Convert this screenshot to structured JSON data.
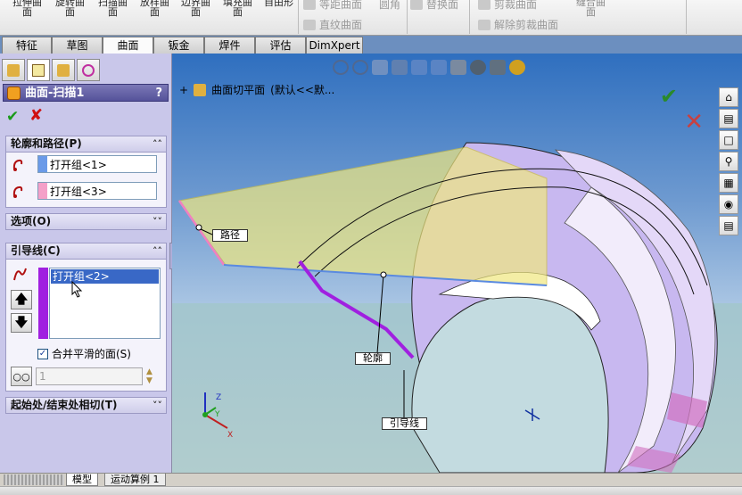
{
  "ribbon": {
    "commands": [
      {
        "top": "拉伸曲",
        "bottom": "面"
      },
      {
        "top": "旋转曲",
        "bottom": "面"
      },
      {
        "top": "扫描曲",
        "bottom": "面"
      },
      {
        "top": "放样曲",
        "bottom": "面"
      },
      {
        "top": "边界曲",
        "bottom": "面"
      },
      {
        "top": "填充曲",
        "bottom": "面"
      },
      {
        "top": "自由形",
        "bottom": ""
      }
    ],
    "small_commands": [
      {
        "label": "等距曲面",
        "icon": "offset-surface-icon"
      },
      {
        "label": "直纹曲面",
        "icon": "ruled-surface-icon"
      },
      {
        "label": "圆角",
        "icon": "fillet-icon"
      },
      {
        "label": "替换面",
        "icon": "replace-face-icon"
      },
      {
        "label": "剪裁曲面",
        "icon": "trim-surface-icon"
      },
      {
        "label": "解除剪裁曲面",
        "icon": "untrim-surface-icon"
      },
      {
        "label": "缝合曲",
        "icon": "knit-surface-icon",
        "sub": "面"
      }
    ]
  },
  "tabs": {
    "items": [
      "特征",
      "草图",
      "曲面",
      "钣金",
      "焊件",
      "评估",
      "DimXpert"
    ],
    "active": "曲面"
  },
  "property_manager": {
    "title": "曲面-扫描1",
    "help": "?",
    "ok_icon": "checkmark-icon",
    "cancel_icon": "x-icon",
    "sections": {
      "profile_path": {
        "header": "轮廓和路径(P)",
        "profile_value": "打开组<1>",
        "profile_color": "#6a9ae8",
        "path_value": "打开组<3>",
        "path_color": "#f4a0c8"
      },
      "options": {
        "header": "选项(O)"
      },
      "guide_curves": {
        "header": "引导线(C)",
        "selected": "打开组<2>",
        "list_color": "#a020e0",
        "merge_label": "合并平滑的面(S)",
        "merge_checked": true,
        "spin_value": "1"
      },
      "tangency": {
        "header": "起始处/结束处相切(T)"
      }
    }
  },
  "graphics": {
    "feature_tree_item": "曲面切平面",
    "feature_tree_suffix": "(默认<<默...",
    "labels": {
      "path": "路径",
      "profile": "轮廓",
      "guide": "引导线"
    },
    "axes": {
      "x": "X",
      "y": "Y",
      "z": "Z"
    }
  },
  "bottom_tabs": {
    "items": [
      "模型",
      "运动算例 1"
    ],
    "active": "模型"
  },
  "colors": {
    "panel_bg": "#c9c7ea",
    "active_header": "#55529a",
    "viewport_top": "#2f6fbf"
  }
}
